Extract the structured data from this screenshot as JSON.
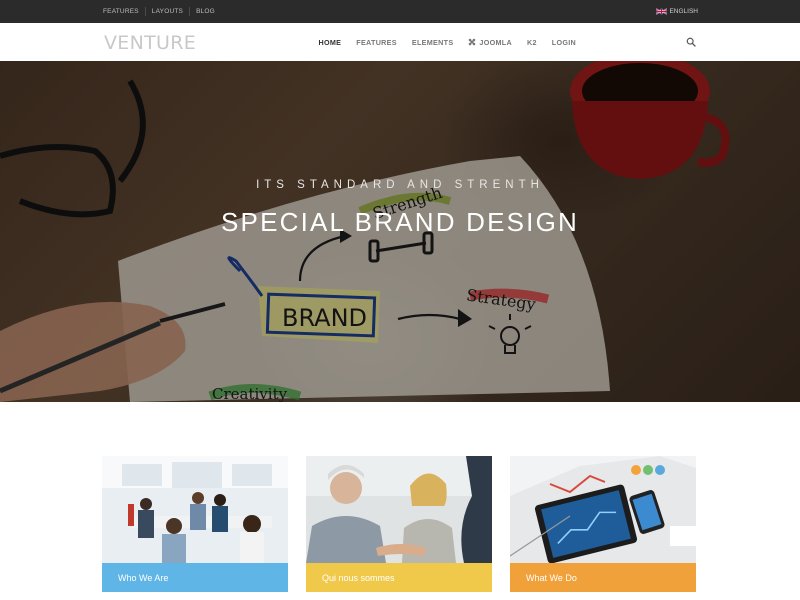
{
  "topbar": {
    "links": [
      "FEATURES",
      "LAYOUTS",
      "BLOG"
    ],
    "language": "ENGLISH"
  },
  "header": {
    "logo": "VENTURE",
    "nav": [
      {
        "label": "HOME",
        "active": true
      },
      {
        "label": "FEATURES",
        "active": false
      },
      {
        "label": "ELEMENTS",
        "active": false
      },
      {
        "label": "JOOMLA",
        "active": false,
        "icon": "joomla-icon"
      },
      {
        "label": "K2",
        "active": false
      },
      {
        "label": "LOGIN",
        "active": false
      }
    ],
    "search_icon": "search-icon"
  },
  "hero": {
    "eyebrow": "ITS STANDARD AND STRENTH",
    "title": "SPECIAL BRAND DESIGN",
    "sketch_words": [
      "BRAND",
      "Strength",
      "Strategy",
      "Creativity"
    ]
  },
  "cards": [
    {
      "label": "Who We Are",
      "color": "#5fb5e6"
    },
    {
      "label": "Qui nous sommes",
      "color": "#f1c94a"
    },
    {
      "label": "What We Do",
      "color": "#f0a13a"
    }
  ],
  "colors": {
    "topbar_bg": "#2b2b2b",
    "hero_overlay": "rgba(0,0,0,0.28)"
  }
}
